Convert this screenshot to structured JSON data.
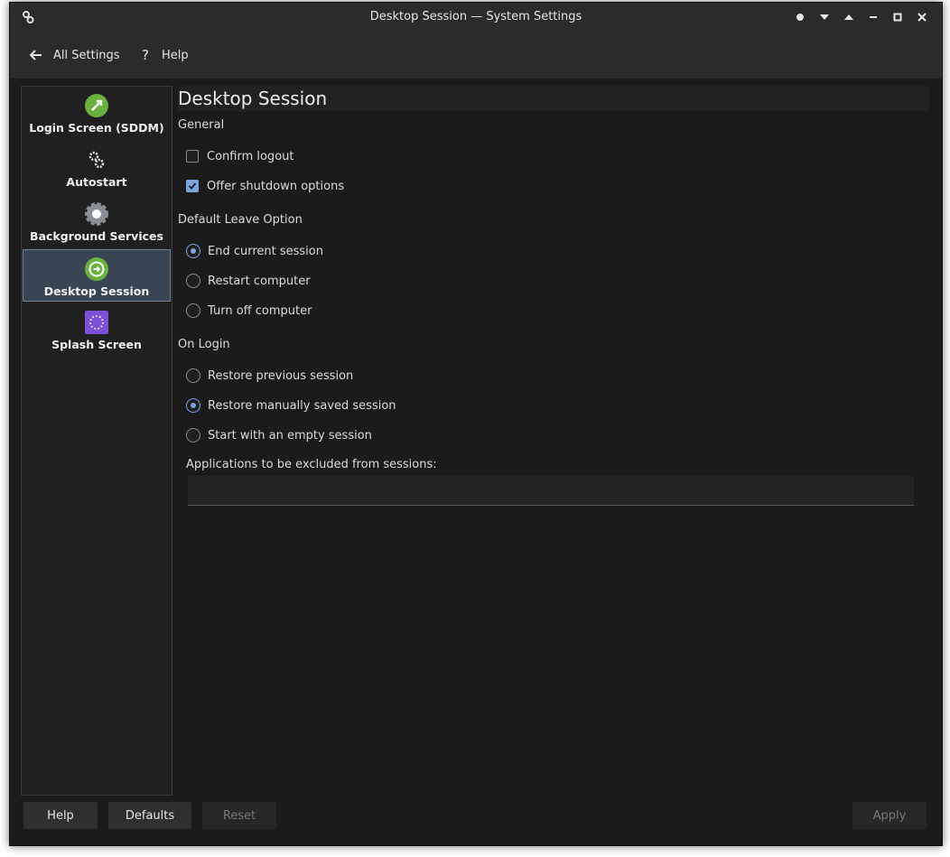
{
  "window": {
    "title": "Desktop Session — System Settings"
  },
  "toolbar": {
    "all_settings": "All Settings",
    "help": "Help"
  },
  "sidebar": {
    "items": [
      {
        "label": "Login Screen (SDDM)",
        "icon": "login-screen-icon",
        "color": "#6ab140"
      },
      {
        "label": "Autostart",
        "icon": "gears-icon"
      },
      {
        "label": "Background Services",
        "icon": "gear-icon"
      },
      {
        "label": "Desktop Session",
        "icon": "session-icon",
        "color": "#6ab140",
        "selected": true
      },
      {
        "label": "Splash Screen",
        "icon": "splash-icon",
        "color": "#7b52d6"
      }
    ]
  },
  "page": {
    "title": "Desktop Session",
    "general": {
      "heading": "General",
      "confirm_logout": {
        "label": "Confirm logout",
        "checked": false
      },
      "offer_shutdown": {
        "label": "Offer shutdown options",
        "checked": true
      }
    },
    "leave": {
      "heading": "Default Leave Option",
      "options": [
        {
          "label": "End current session",
          "checked": true
        },
        {
          "label": "Restart computer",
          "checked": false
        },
        {
          "label": "Turn off computer",
          "checked": false
        }
      ]
    },
    "login": {
      "heading": "On Login",
      "options": [
        {
          "label": "Restore previous session",
          "checked": false
        },
        {
          "label": "Restore manually saved session",
          "checked": true
        },
        {
          "label": "Start with an empty session",
          "checked": false
        }
      ]
    },
    "excluded_label": "Applications to be excluded from sessions:",
    "excluded_value": ""
  },
  "buttons": {
    "help": "Help",
    "defaults": "Defaults",
    "reset": "Reset",
    "apply": "Apply"
  },
  "colors": {
    "accent": "#7ea4e0",
    "selection_bg": "#3a4554"
  }
}
